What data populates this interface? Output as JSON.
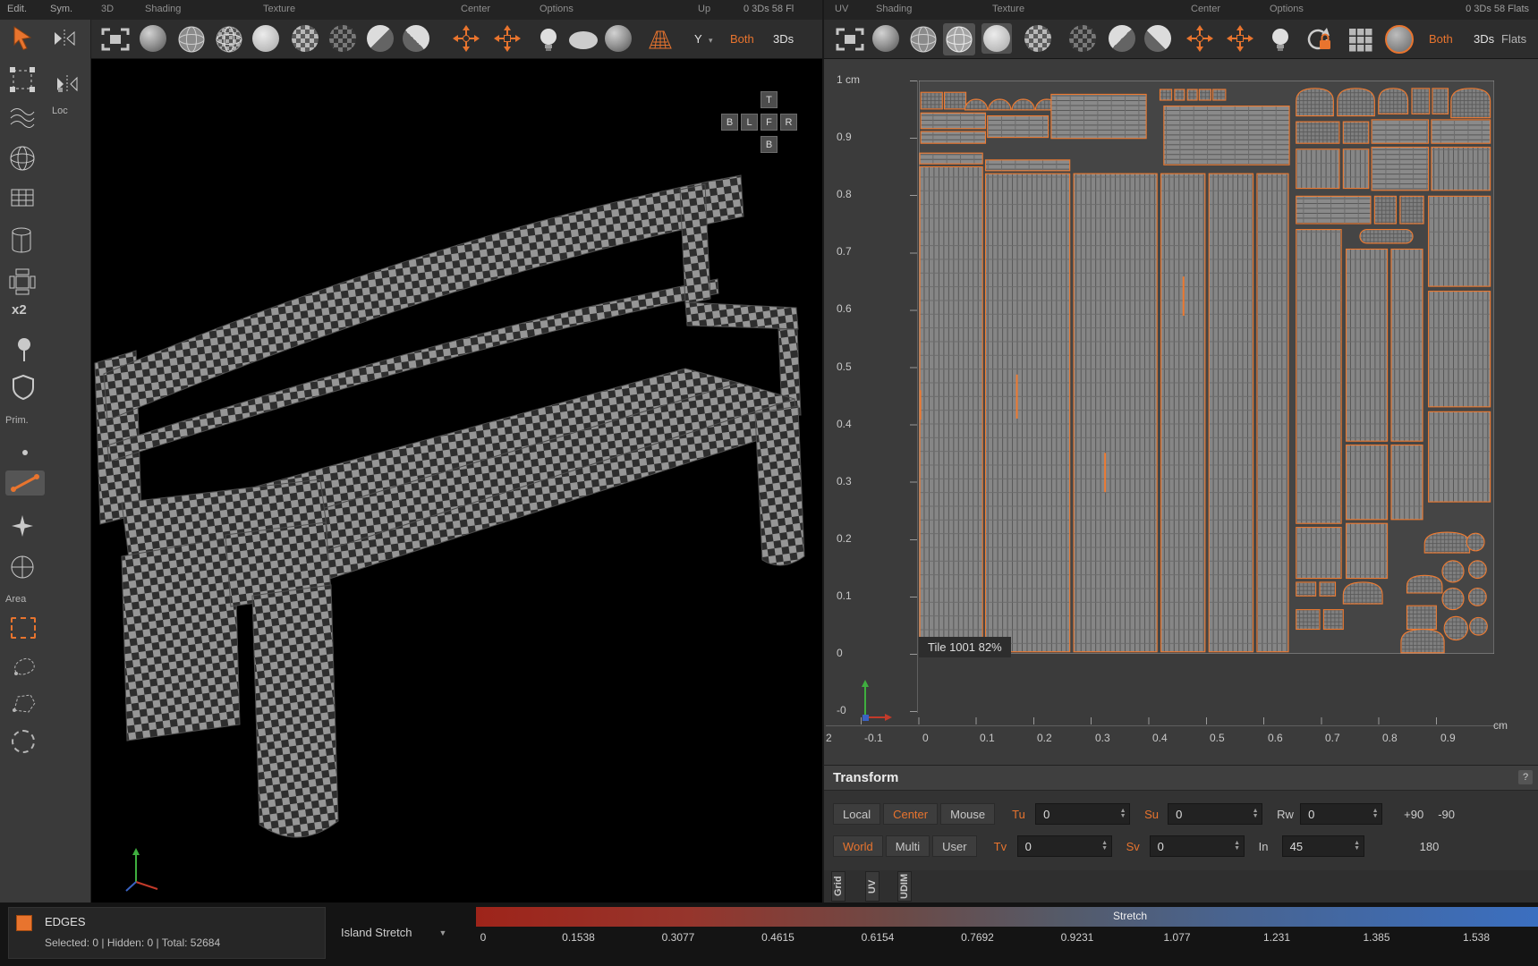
{
  "accent_color": "#e8742e",
  "sidebar": {
    "edit": "Edit.",
    "sym": "Sym.",
    "loc": "Loc",
    "x2": "x2",
    "prim": "Prim.",
    "area": "Area"
  },
  "toolbar3d": {
    "label_3d": "3D",
    "label_shading": "Shading",
    "label_texture": "Texture",
    "label_center": "Center",
    "label_options": "Options",
    "label_up": "Up",
    "counter": "0 3Ds 58 Fl",
    "axis_value": "Y",
    "both": "Both",
    "threeds": "3Ds"
  },
  "toolbaruv": {
    "label_uv": "UV",
    "label_shading": "Shading",
    "label_texture": "Texture",
    "label_center": "Center",
    "label_options": "Options",
    "counter": "0 3Ds 58 Flats",
    "both": "Both",
    "threeds": "3Ds",
    "flats": "Flats"
  },
  "viewcube": {
    "top": "T",
    "row": [
      "B",
      "L",
      "F",
      "R"
    ],
    "bottom": "B"
  },
  "uv": {
    "unit_top": "1 cm",
    "ruler_v": [
      "0.9",
      "0.8",
      "0.7",
      "0.6",
      "0.5",
      "0.4",
      "0.3",
      "0.2",
      "0.1",
      "0",
      "-0"
    ],
    "ruler_h": [
      "2",
      "-0.1",
      "0",
      "0.1",
      "0.2",
      "0.3",
      "0.4",
      "0.5",
      "0.6",
      "0.7",
      "0.8",
      "0.9"
    ],
    "unit_h": "cm",
    "tile": "Tile 1001 82%"
  },
  "transform": {
    "title": "Transform",
    "help": "?",
    "local": "Local",
    "center": "Center",
    "mouse": "Mouse",
    "world": "World",
    "multi": "Multi",
    "user": "User",
    "tu": "Tu",
    "tu_val": "0",
    "su": "Su",
    "su_val": "0",
    "rw": "Rw",
    "rw_val": "0",
    "tv": "Tv",
    "tv_val": "0",
    "sv": "Sv",
    "sv_val": "0",
    "in": "In",
    "in_val": "45",
    "p90": "+90",
    "m90": "-90",
    "d180": "180"
  },
  "tabs": {
    "grid": "Grid",
    "uv": "UV",
    "udim": "UDIM"
  },
  "status": {
    "mode": "EDGES",
    "selection": "Selected: 0 | Hidden: 0 | Total: 52684",
    "metric": "Island Stretch",
    "legend_title": "Stretch",
    "ticks": [
      "0",
      "0.1538",
      "0.3077",
      "0.4615",
      "0.6154",
      "0.7692",
      "0.9231",
      "1.077",
      "1.231",
      "1.385",
      "1.538"
    ]
  }
}
